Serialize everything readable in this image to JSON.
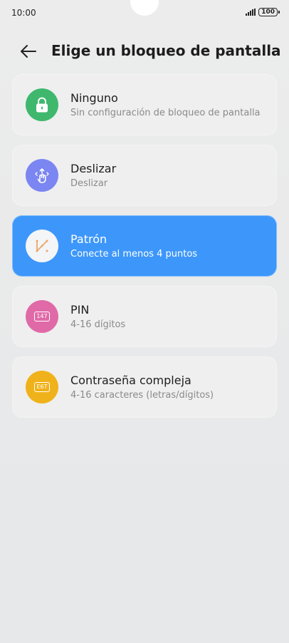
{
  "status_bar": {
    "time": "10:00",
    "battery": "100"
  },
  "header": {
    "title": "Elige un bloqueo de pantalla",
    "back_icon": "arrow-left-icon"
  },
  "options": [
    {
      "title": "Ninguno",
      "subtitle": "Sin configuración de bloqueo de pantalla",
      "icon": "lock-icon",
      "icon_color": "#3fb86e",
      "selected": false
    },
    {
      "title": "Deslizar",
      "subtitle": "Deslizar",
      "icon": "swipe-hand-icon",
      "icon_color": "#7b86f2",
      "selected": false
    },
    {
      "title": "Patrón",
      "subtitle": "Conecte al menos 4 puntos",
      "icon": "pattern-icon",
      "icon_color": "#ffffff",
      "selected": true
    },
    {
      "title": "PIN",
      "subtitle": "4-16 dígitos",
      "icon": "pin-icon",
      "icon_color": "#e06aa8",
      "icon_text": "147",
      "selected": false
    },
    {
      "title": "Contraseña compleja",
      "subtitle": "4-16 caracteres (letras/dígitos)",
      "icon": "password-icon",
      "icon_color": "#f0b21a",
      "icon_text": "E6T",
      "selected": false
    }
  ],
  "colors": {
    "selected_bg": "#3d97fb",
    "card_bg": "#efefef"
  }
}
